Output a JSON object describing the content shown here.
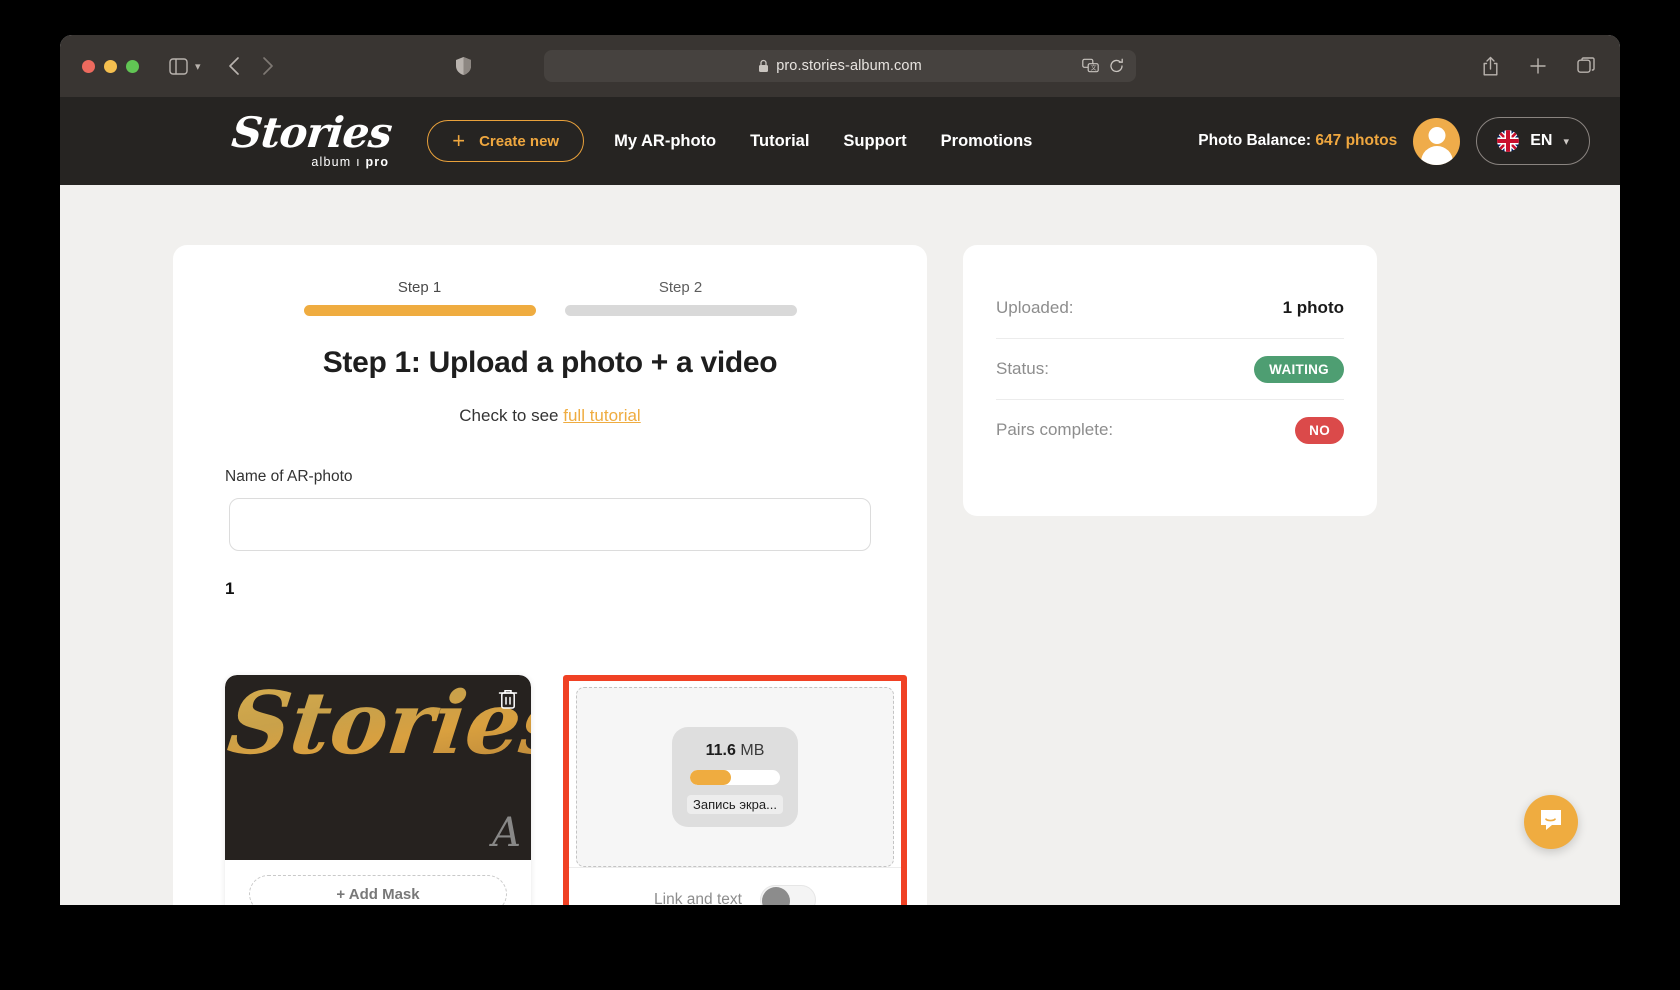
{
  "browser": {
    "url": "pro.stories-album.com",
    "icons": {
      "sidebar": "sidebar-icon",
      "sidebar_chevron": "chevron-down-icon",
      "back": "chevron-left-icon",
      "forward": "chevron-right-icon",
      "shield": "shield-icon",
      "lock": "lock-icon",
      "translate": "translate-icon",
      "reload": "reload-icon",
      "share": "share-icon",
      "new_tab": "plus-icon",
      "tabs": "tab-overview-icon"
    }
  },
  "header": {
    "brand_wordmark": "Stories",
    "brand_sub_prefix": "album ı ",
    "brand_sub_bold": "pro",
    "create_new_label": "Create new",
    "create_new_plus": "+",
    "nav": [
      {
        "label": "My AR-photo"
      },
      {
        "label": "Tutorial"
      },
      {
        "label": "Support"
      },
      {
        "label": "Promotions"
      }
    ],
    "photo_balance_label": "Photo Balance: ",
    "photo_balance_value": "647 photos",
    "language_code": "EN",
    "language_chevron": "⌄"
  },
  "upload_card": {
    "steps": [
      {
        "label": "Step 1",
        "active": true
      },
      {
        "label": "Step 2",
        "active": false
      }
    ],
    "title": "Step 1: Upload a photo + a video",
    "tutorial_prefix": "Check to see ",
    "tutorial_link": "full tutorial",
    "field_label": "Name of AR-photo",
    "name_value": "",
    "name_placeholder": "",
    "pair_index": "1",
    "photo": {
      "thumb_text": "Stories",
      "thumb_sub": "A",
      "delete_icon": "trash-icon",
      "add_mask_label": "+ Add Mask"
    },
    "video": {
      "file_size_value": "11.6",
      "file_size_unit": "MB",
      "progress_percent": 45,
      "file_name": "Запись экра...",
      "link_text_label": "Link and text",
      "link_text_enabled": false
    }
  },
  "status_card": {
    "rows": [
      {
        "key": "Uploaded:",
        "value": "1 photo",
        "type": "text"
      },
      {
        "key": "Status:",
        "value": "WAITING",
        "type": "badge-green"
      },
      {
        "key": "Pairs complete:",
        "value": "NO",
        "type": "badge-red"
      }
    ]
  },
  "chat": {
    "icon": "chat-bubble-icon"
  },
  "colors": {
    "accent": "#EFAC40",
    "header_bg": "#262422",
    "toolbar_bg": "#393532",
    "highlight": "#F04124",
    "green": "#4E9E72",
    "red": "#DB4A4A"
  }
}
